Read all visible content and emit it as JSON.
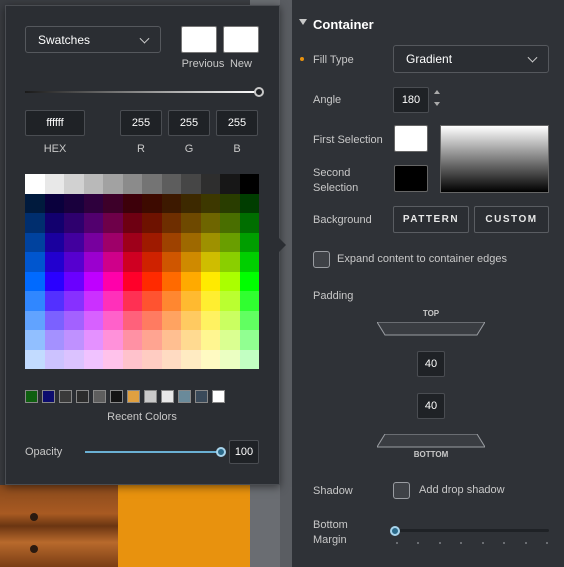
{
  "picker": {
    "mode_label": "Swatches",
    "previous_label": "Previous",
    "new_label": "New",
    "hex_value": "ffffff",
    "r_value": "255",
    "g_value": "255",
    "b_value": "255",
    "hex_label": "HEX",
    "r_label": "R",
    "g_label": "G",
    "b_label": "B",
    "recent_label": "Recent Colors",
    "recent_colors": [
      "#0f5f10",
      "#0c0c6e",
      "#3a3a3a",
      "#2c2c2c",
      "#5e5e5e",
      "#141414",
      "#e0a040",
      "#c9c9c9",
      "#e8e8e8",
      "#6a8a9a",
      "#3a4a5a",
      "#ffffff"
    ],
    "opacity_label": "Opacity",
    "opacity_value": "100",
    "opacity_fraction": 1.0
  },
  "panel": {
    "section_title": "Container",
    "fill_type_label": "Fill Type",
    "fill_type_value": "Gradient",
    "angle_label": "Angle",
    "angle_value": "180",
    "first_selection_label": "First Selection",
    "second_selection_label": "Second Selection",
    "background_label": "Background",
    "pattern_label": "PATTERN",
    "custom_label": "CUSTOM",
    "expand_label": "Expand content to container edges",
    "padding_label": "Padding",
    "top_label": "TOP",
    "bottom_label": "BOTTOM",
    "padding_top_value": "40",
    "padding_bottom_value": "40",
    "shadow_label": "Shadow",
    "shadow_checkbox_label": "Add drop shadow",
    "bottom_margin_label": "Bottom Margin",
    "bottom_margin_fraction": 0.0,
    "first_color": "#ffffff",
    "second_color": "#000000",
    "accent": "#e8920e"
  }
}
